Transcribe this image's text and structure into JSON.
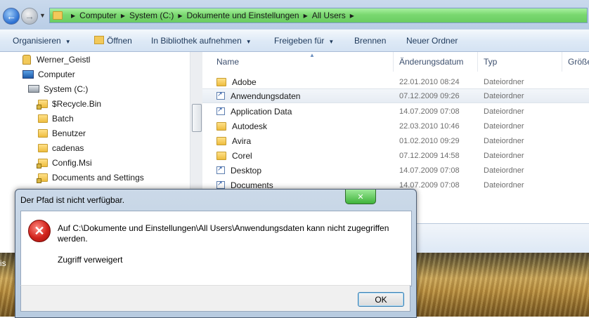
{
  "address_bar": {
    "breadcrumbs": [
      "Computer",
      "System (C:)",
      "Dokumente und Einstellungen",
      "All Users"
    ]
  },
  "toolbar": {
    "organize_label": "Organisieren",
    "open_label": "Öffnen",
    "library_label": "In Bibliothek aufnehmen",
    "share_label": "Freigeben für",
    "burn_label": "Brennen",
    "new_folder_label": "Neuer Ordner"
  },
  "nav_tree": {
    "items": [
      {
        "label": "Werner_Geistl",
        "icon": "user-icon"
      },
      {
        "label": "Computer",
        "icon": "computer-icon"
      },
      {
        "label": "System (C:)",
        "icon": "drive-icon"
      },
      {
        "label": "$Recycle.Bin",
        "icon": "locked-folder-icon"
      },
      {
        "label": "Batch",
        "icon": "folder-icon"
      },
      {
        "label": "Benutzer",
        "icon": "folder-icon"
      },
      {
        "label": "cadenas",
        "icon": "folder-icon"
      },
      {
        "label": "Config.Msi",
        "icon": "locked-folder-icon"
      },
      {
        "label": "Documents and Settings",
        "icon": "locked-folder-icon"
      }
    ]
  },
  "file_list": {
    "columns": [
      "Name",
      "Änderungsdatum",
      "Typ",
      "Größe"
    ],
    "rows": [
      {
        "name": "Adobe",
        "date": "22.01.2010 08:24",
        "type": "Dateiordner",
        "icon": "folder-icon"
      },
      {
        "name": "Anwendungsdaten",
        "date": "07.12.2009 09:26",
        "type": "Dateiordner",
        "icon": "shortcut-icon",
        "selected": true
      },
      {
        "name": "Application Data",
        "date": "14.07.2009 07:08",
        "type": "Dateiordner",
        "icon": "shortcut-icon"
      },
      {
        "name": "Autodesk",
        "date": "22.03.2010 10:46",
        "type": "Dateiordner",
        "icon": "folder-icon"
      },
      {
        "name": "Avira",
        "date": "01.02.2010 09:29",
        "type": "Dateiordner",
        "icon": "folder-icon"
      },
      {
        "name": "Corel",
        "date": "07.12.2009 14:58",
        "type": "Dateiordner",
        "icon": "folder-icon"
      },
      {
        "name": "Desktop",
        "date": "14.07.2009 07:08",
        "type": "Dateiordner",
        "icon": "shortcut-icon"
      },
      {
        "name": "Documents",
        "date": "14.07.2009 07:08",
        "type": "Dateiordner",
        "icon": "shortcut-icon"
      }
    ]
  },
  "desktop": {
    "text": "is"
  },
  "dialog": {
    "title": "Der Pfad ist nicht verfügbar.",
    "message": "Auf C:\\Dokumente und Einstellungen\\All Users\\Anwendungsdaten kann nicht zugegriffen werden.",
    "detail": "Zugriff verweigert",
    "ok_label": "OK"
  }
}
